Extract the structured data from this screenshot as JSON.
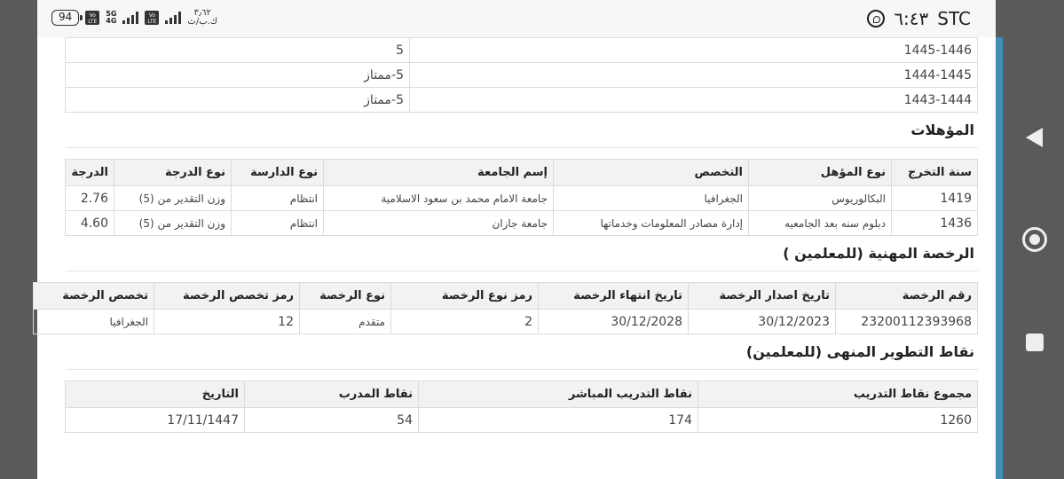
{
  "status_bar": {
    "battery": "94",
    "network1": "5G",
    "net_speed": "٣٫٦٢",
    "net_speed_unit": "ك.ب/ث",
    "time": "٦:٤٣",
    "carrier": "STC"
  },
  "years_table": {
    "rows": [
      {
        "year": "1445-1446",
        "grade": "5"
      },
      {
        "year": "1444-1445",
        "grade": "5-ممتاز"
      },
      {
        "year": "1443-1444",
        "grade": "5-ممتاز"
      }
    ]
  },
  "qualifications": {
    "title": "المؤهلات",
    "headers": [
      "سنة التخرج",
      "نوع المؤهل",
      "التخصص",
      "إسم الجامعة",
      "نوع الدارسة",
      "نوع الدرجة",
      "الدرجة"
    ],
    "rows": [
      [
        "1419",
        "البكالوريوس",
        "الجغرافيا",
        "جامعة الامام محمد بن سعود الاسلامية",
        "انتظام",
        "وزن التقدير من (5)",
        "2.76"
      ],
      [
        "1436",
        "دبلوم سنه بعد الجامعيه",
        "إدارة مصادر المعلومات وخدماتها",
        "جامعة جازان",
        "انتظام",
        "وزن التقدير من (5)",
        "4.60"
      ]
    ]
  },
  "license": {
    "title": "الرخصة المهنية (للمعلمين )",
    "headers": [
      "رقم الرخصة",
      "تاريخ اصدار الرخصة",
      "تاريخ انتهاء الرخصة",
      "رمز نوع الرخصة",
      "نوع الرخصة",
      "رمز تخصص الرخصة",
      "تخصص الرخصة"
    ],
    "row": [
      "23200112393968",
      "30/12/2023",
      "30/12/2028",
      "2",
      "متقدم",
      "12",
      "الجغرافيا"
    ]
  },
  "development": {
    "title": "نقاط التطوير المنهى (للمعلمين)",
    "headers": [
      "مجموع نقاط التدريب",
      "نقاط التدريب المباشر",
      "نقاط المدرب",
      "التاريخ"
    ],
    "row": [
      "1260",
      "174",
      "54",
      "17/11/1447"
    ]
  }
}
